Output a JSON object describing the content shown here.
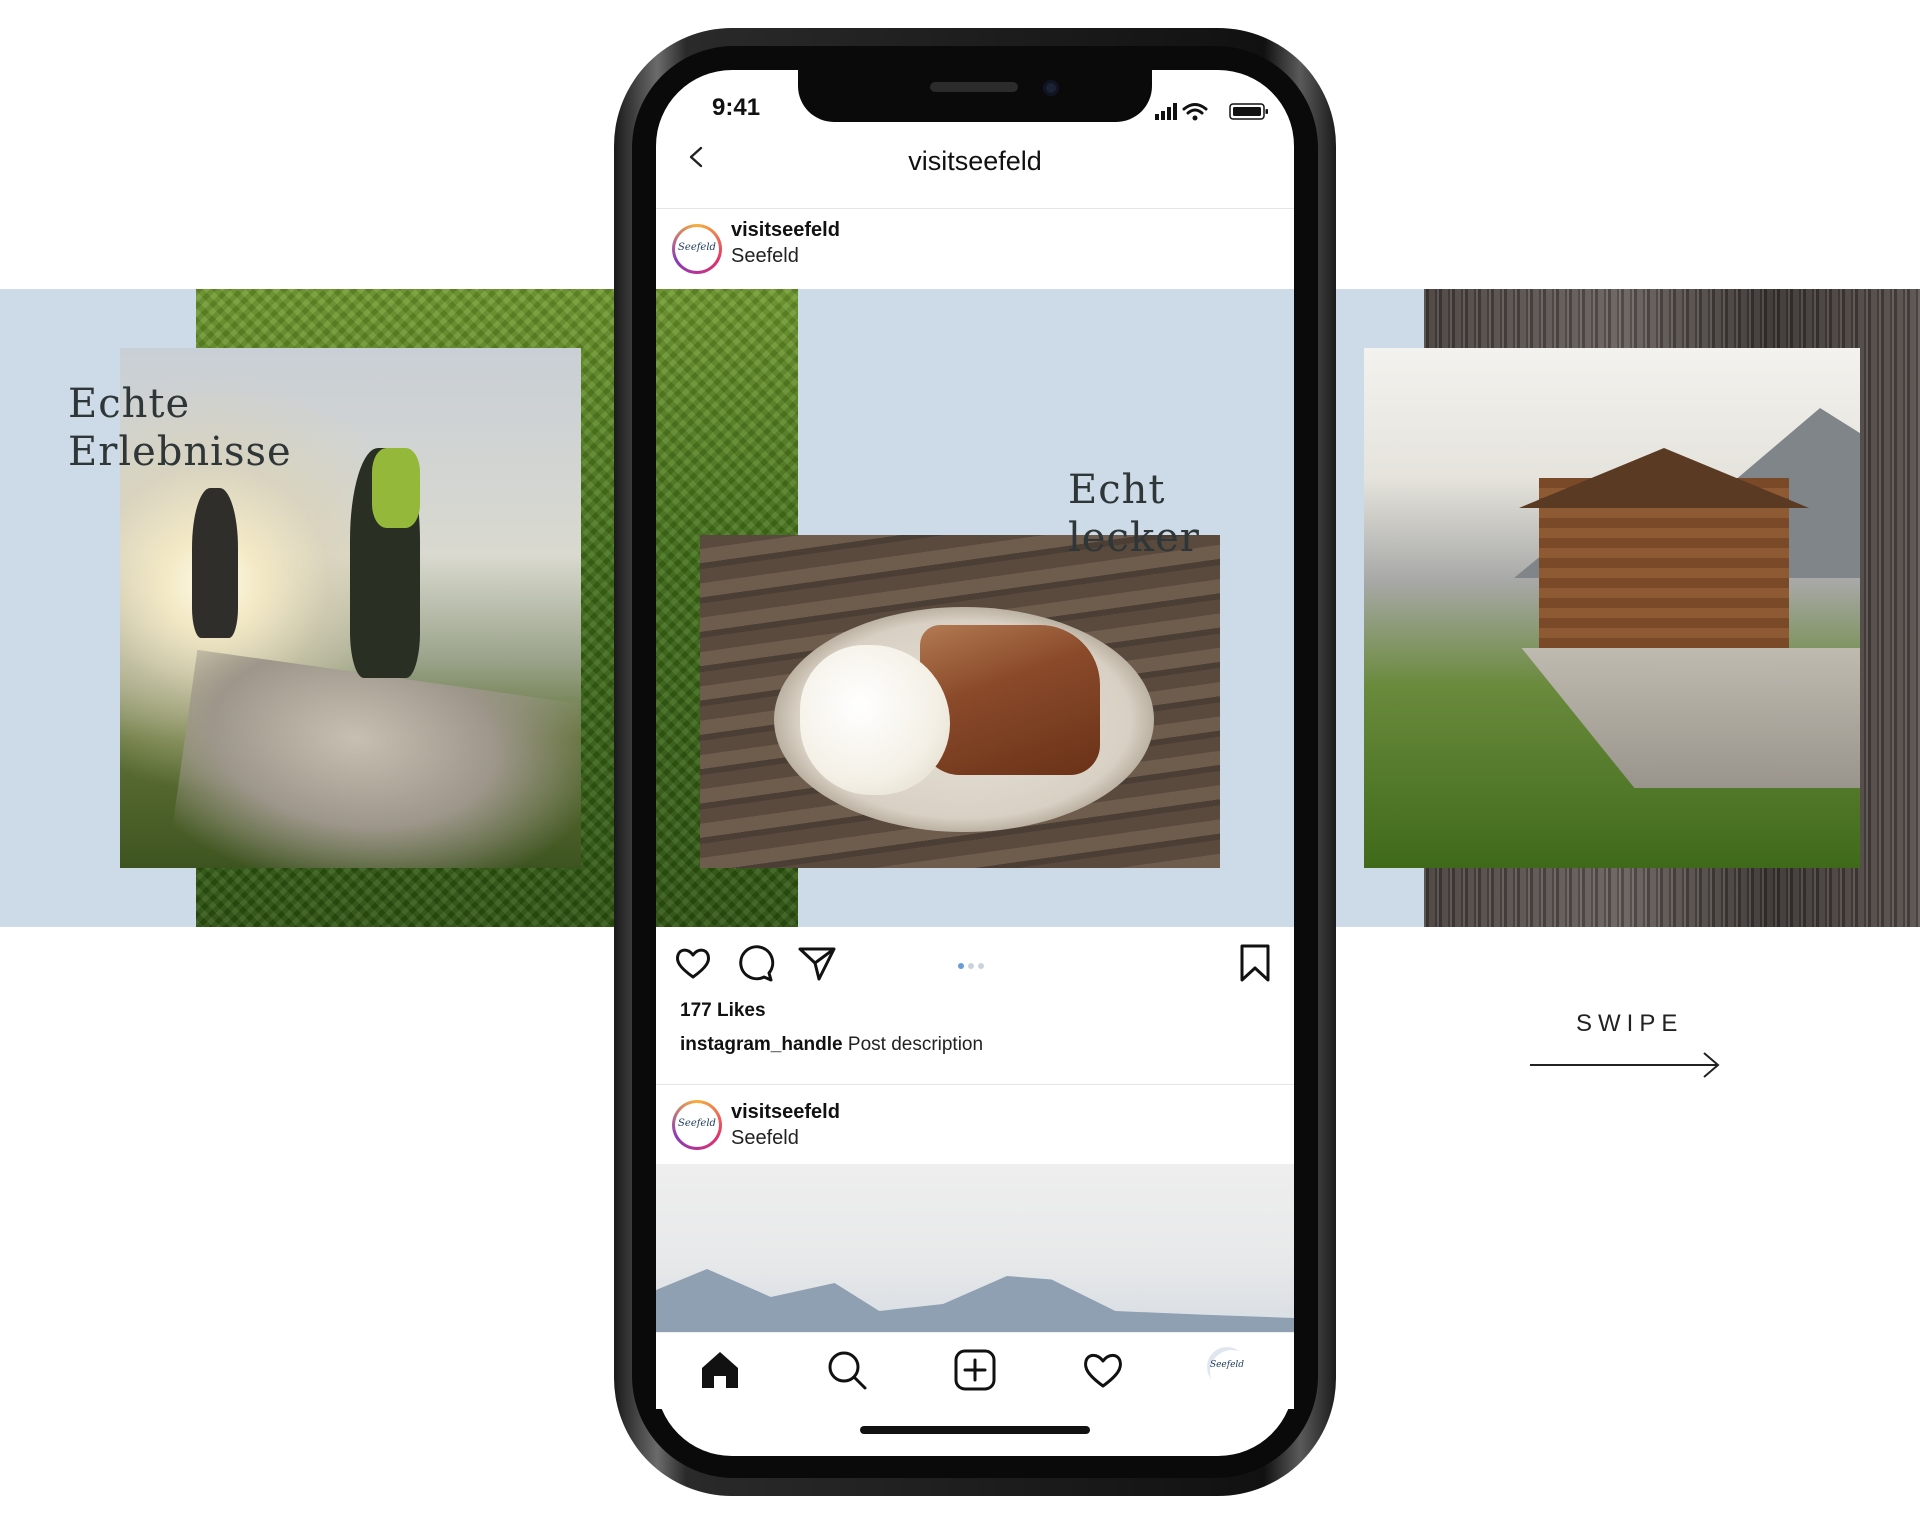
{
  "slides": {
    "left_text": [
      "Echte",
      "Erlebnisse"
    ],
    "center_text": [
      "Echt",
      "lecker"
    ]
  },
  "phone": {
    "status": {
      "time": "9:41"
    },
    "nav": {
      "title": "visitseefeld"
    },
    "post": {
      "username": "visitseefeld",
      "location": "Seefeld",
      "avatar_text": "Seefeld",
      "likes": "177 Likes",
      "caption_handle": "instagram_handle",
      "caption_text": "Post description",
      "carousel_page": 1,
      "carousel_total": 3
    },
    "next_post": {
      "username": "visitseefeld",
      "location": "Seefeld",
      "avatar_text": "Seefeld"
    },
    "tabbar": {
      "icons": [
        "home-icon",
        "search-icon",
        "add-post-icon",
        "heart-icon",
        "profile-avatar"
      ],
      "avatar_text": "Seefeld"
    }
  },
  "swipe": {
    "label": "SWIPE"
  },
  "colors": {
    "band_blue": "#cddbe9",
    "accent_dot": "#6a9ad8"
  }
}
